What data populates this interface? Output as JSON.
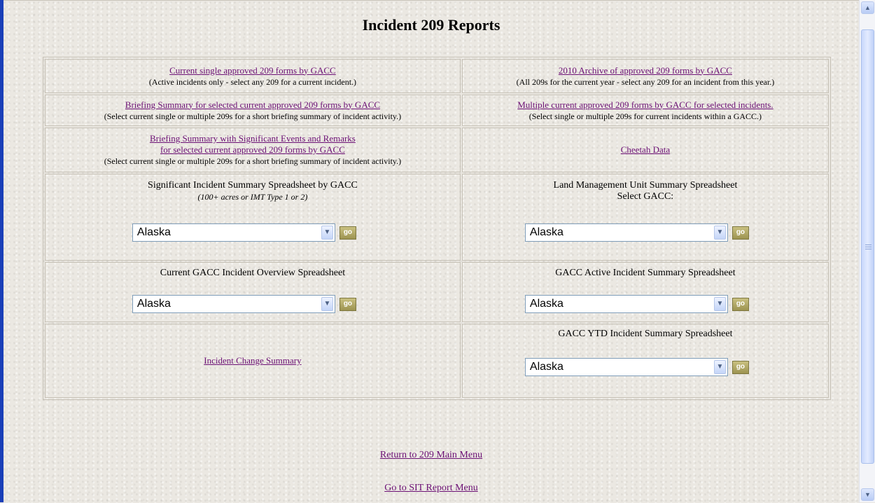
{
  "page": {
    "title": "Incident 209 Reports"
  },
  "cells": {
    "current_single": {
      "link": "Current single approved 209 forms by GACC",
      "note": "(Active incidents only - select any 209 for a current incident.)"
    },
    "archive_2010": {
      "link": "2010 Archive of approved 209 forms by GACC",
      "note": "(All 209s for the current year - select any 209 for an incident from this year.)"
    },
    "briefing_summary": {
      "link": "Briefing Summary for selected current approved 209 forms by GACC",
      "note": "(Select current single or multiple 209s for a short briefing summary of incident activity.)"
    },
    "multiple_current": {
      "link": "Multiple current approved 209 forms by GACC for selected incidents.",
      "note": "(Select single or multiple 209s for current incidents within a GACC.)"
    },
    "briefing_significant": {
      "link_line1": "Briefing Summary with Significant Events and Remarks",
      "link_line2": "for selected current approved 209 forms by GACC",
      "note": "(Select current single or multiple 209s for a short briefing summary of incident activity.)"
    },
    "cheetah": {
      "link": "Cheetah Data"
    },
    "significant_spreadsheet": {
      "heading": "Significant Incident Summary Spreadsheet by GACC",
      "subheading": "(100+ acres or IMT Type 1 or 2)",
      "selected": "Alaska",
      "go_label": "go"
    },
    "land_management": {
      "heading": "Land Management Unit Summary Spreadsheet",
      "subheading": "Select GACC:",
      "selected": "Alaska",
      "go_label": "go"
    },
    "gacc_overview": {
      "heading": "Current GACC Incident Overview Spreadsheet",
      "selected": "Alaska",
      "go_label": "go"
    },
    "gacc_active": {
      "heading": "GACC Active Incident Summary Spreadsheet",
      "selected": "Alaska",
      "go_label": "go"
    },
    "incident_change": {
      "link": "Incident Change Summary"
    },
    "gacc_ytd": {
      "heading": "GACC YTD Incident Summary Spreadsheet",
      "selected": "Alaska",
      "go_label": "go"
    }
  },
  "footer": {
    "return_link": "Return to 209 Main Menu",
    "sit_link": "Go to SIT Report Menu"
  },
  "colors": {
    "link": "#6b0f74",
    "left_border": "#1a3fb8",
    "background": "#ebe8e2"
  },
  "icons": {
    "select_arrow": "chevron-down-icon",
    "scroll_up": "scroll-up-icon",
    "scroll_down": "scroll-down-icon"
  }
}
